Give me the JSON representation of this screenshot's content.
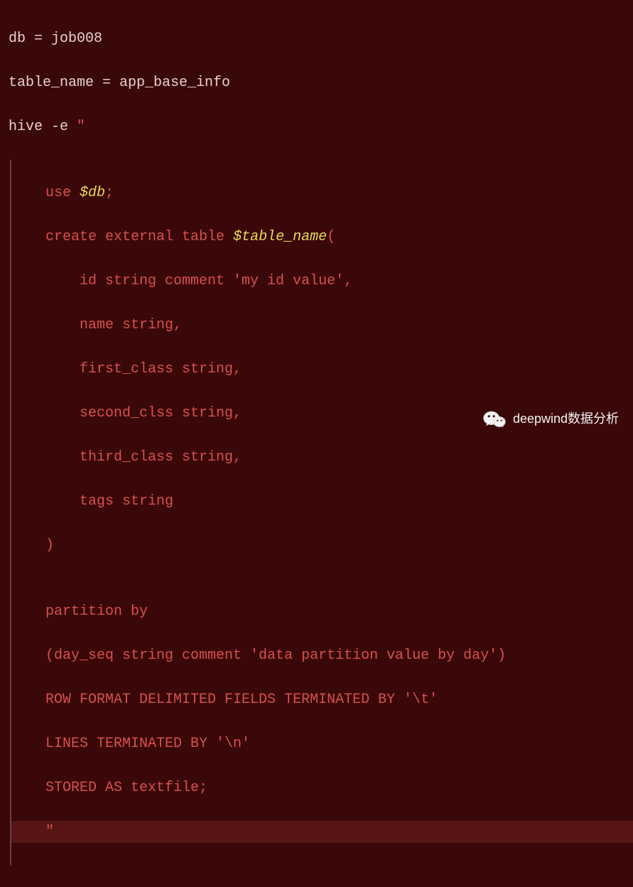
{
  "code": {
    "line1_a": "db ",
    "line1_b": "= job008",
    "line2_a": "table_name ",
    "line2_b": "= app_base_info",
    "line3_a": "hive -e ",
    "line3_b": "\"",
    "line4_a": "    use ",
    "line4_b": "$db",
    "line4_c": ";",
    "line5_a": "    create external table ",
    "line5_b": "$table_name",
    "line5_c": "(",
    "line6": "        id string comment 'my id value',",
    "line7": "        name string,",
    "line8": "        first_class string,",
    "line9": "        second_clss string,",
    "line10": "        third_class string,",
    "line11": "        tags string",
    "line12": "    )",
    "line13": "",
    "line14": "    partition by",
    "line15": "    (day_seq string comment 'data partition value by day')",
    "line16": "    ROW FORMAT DELIMITED FIELDS TERMINATED BY '\\t'",
    "line17": "    LINES TERMINATED BY '\\n'",
    "line18": "    STORED AS textfile;",
    "line19": "    \""
  },
  "watermark": {
    "text": "deepwind数据分析"
  }
}
